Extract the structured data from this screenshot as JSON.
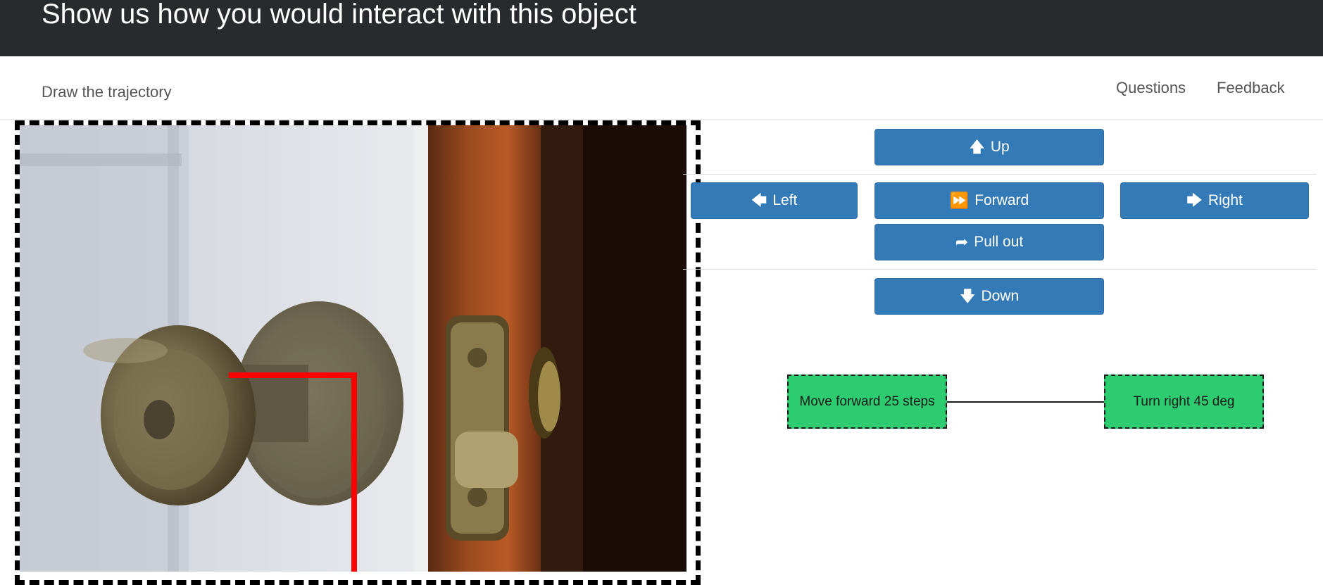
{
  "header": {
    "title": "Show us how you would interact with this object"
  },
  "navbar": {
    "subtitle": "Draw the trajectory",
    "links": [
      "Questions",
      "Feedback"
    ]
  },
  "controls": {
    "up": "Up",
    "left": "Left",
    "forward": "Forward",
    "right": "Right",
    "pull_out": "Pull out",
    "down": "Down"
  },
  "icons": {
    "up": "arrow-up-icon",
    "left": "arrow-left-icon",
    "forward": "fast-forward-icon",
    "right": "arrow-right-icon",
    "pull_out": "share-arrow-icon",
    "down": "arrow-down-icon"
  },
  "sequence": {
    "steps": [
      "Move forward 25 steps",
      "Turn right 45 deg"
    ]
  },
  "colors": {
    "header_bg": "#272b2e",
    "button_primary": "#337ab7",
    "step_node": "#2ecc71",
    "trajectory": "#ff0000"
  }
}
